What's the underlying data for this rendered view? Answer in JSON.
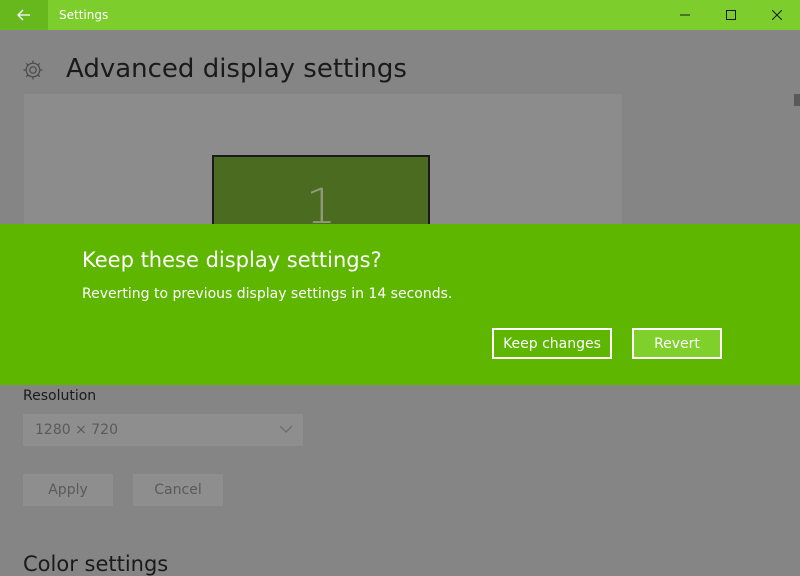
{
  "window": {
    "title": "Settings"
  },
  "page": {
    "title": "Advanced display settings",
    "monitor_number": "1",
    "resolution_label": "Resolution",
    "resolution_value": "1280 × 720",
    "apply_label": "Apply",
    "cancel_label": "Cancel",
    "color_settings_title": "Color settings"
  },
  "dialog": {
    "title": "Keep these display settings?",
    "message": "Reverting to previous display settings in 14 seconds.",
    "keep_label": "Keep changes",
    "revert_label": "Revert"
  },
  "colors": {
    "titlebar": "#7dce2c",
    "dialog_bg": "#5eb600",
    "revert_bg": "#7fd02b",
    "overlay_bg": "#858585"
  },
  "icons": {
    "back": "back-arrow-icon",
    "minimize": "minimize-icon",
    "maximize": "maximize-icon",
    "close": "close-icon",
    "gear": "gear-icon",
    "chevron": "chevron-down-icon"
  }
}
